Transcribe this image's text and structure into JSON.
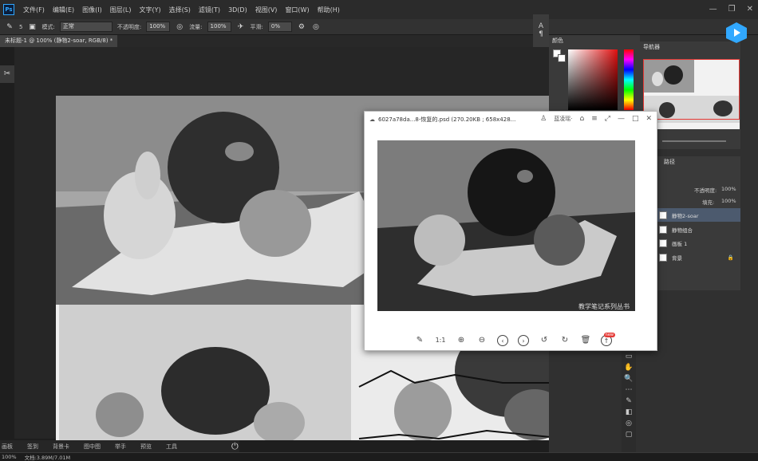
{
  "menubar": {
    "logo": "Ps",
    "items": [
      "文件(F)",
      "编辑(E)",
      "图像(I)",
      "图层(L)",
      "文字(Y)",
      "选择(S)",
      "滤镜(T)",
      "3D(D)",
      "视图(V)",
      "窗口(W)",
      "帮助(H)"
    ]
  },
  "options": {
    "brush_size": "5",
    "mode_label": "模式:",
    "mode_value": "正常",
    "opacity_label": "不透明度:",
    "opacity_value": "100%",
    "flow_label": "流量:",
    "flow_value": "100%",
    "smooth_label": "平滑:",
    "smooth_value": "0%"
  },
  "document": {
    "tab_title": "未标题-1 @ 100% (静物2-soar, RGB/8) *"
  },
  "viewer": {
    "title": "6027a78da...8-恢复的.psd (270.20KB ; 658x428...",
    "account": "蓝凌瑶·",
    "watermark": "教学笔记系列丛书",
    "one_to_one": "1:1",
    "badge": "new"
  },
  "panels": {
    "color_tab": "颜色",
    "navigator_tab": "导航器",
    "paths_tab": "路径",
    "opacity_label": "不透明度:",
    "opacity_value": "100%",
    "fill_label": "填充:",
    "fill_value": "100%",
    "layers": [
      {
        "name": "静物2-soar",
        "active": true
      },
      {
        "name": "静物组合",
        "active": false
      },
      {
        "name": "画板 1",
        "active": false
      },
      {
        "name": "背景",
        "active": false
      }
    ]
  },
  "bottom_tabs": [
    "画板",
    "签到",
    "背景卡",
    "图中图",
    "举手",
    "预览",
    "工具"
  ],
  "status": {
    "zoom": "100%",
    "doc_info": "文档:3.89M/7.01M"
  },
  "colors": {
    "accent": "#31a8ff",
    "selection": "#e53935"
  }
}
